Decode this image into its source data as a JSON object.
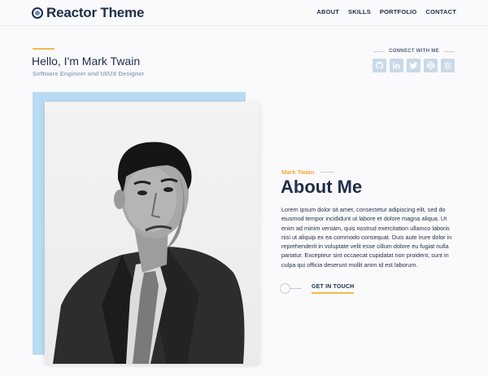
{
  "header": {
    "logo_text": "Reactor Theme",
    "logo_icon": "reactor-logo-icon",
    "nav": [
      "ABOUT",
      "SKILLS",
      "PORTFOLIO",
      "CONTACT"
    ]
  },
  "intro": {
    "greeting": "Hello, I'm Mark Twain",
    "role": "Software Engineer and UI/UX Designer"
  },
  "connect": {
    "title": "CONNECT WITH ME",
    "icons": [
      "github-icon",
      "linkedin-icon",
      "twitter-icon",
      "codepen-icon",
      "cog-icon"
    ]
  },
  "about": {
    "kicker": "Mark Twain",
    "title": "About Me",
    "body": "Lorem ipsum dolor sit amet, consectetur adipiscing elit, sed do eiusmod tempor incididunt ut labore et dolore magna aliqua. Ut enim ad minim veniam, quis nostrud exercitation ullamco laboris nisi ut aliquip ex ea commodo consequat. Duis aute irure dolor in reprehenderit in voluptate velit esse cillum dolore eu fugiat nulla pariatur. Excepteur sint occaecat cupidatat non proident, sunt in culpa qui officia deserunt mollit anim id est laborum.",
    "cta": "GET IN TOUCH"
  },
  "colors": {
    "navy": "#1f2d48",
    "accent": "#f4b94e",
    "photo_backdrop": "#b9daf3",
    "social_bg": "#c9d9e9"
  }
}
